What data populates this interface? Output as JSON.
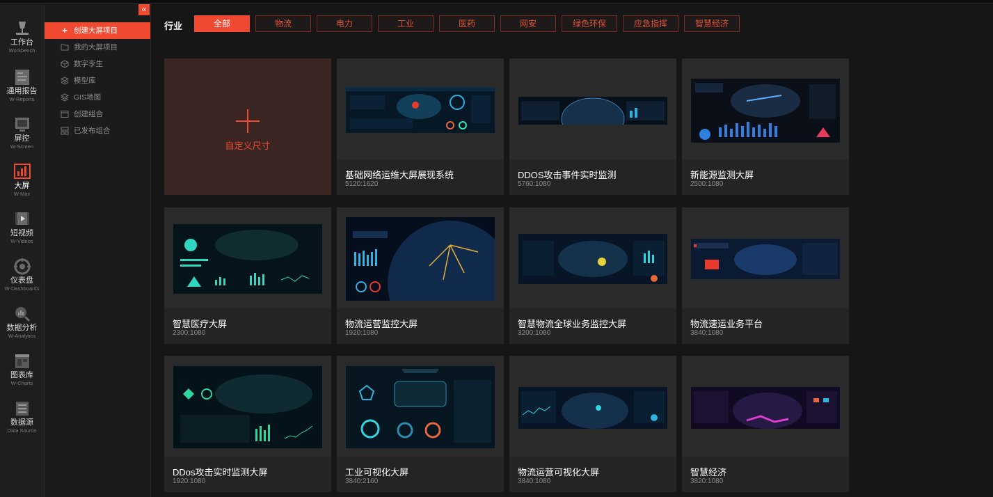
{
  "rail": [
    {
      "label": "工作台",
      "sub": "Workbench",
      "icon": "workbench-icon"
    },
    {
      "label": "通用报告",
      "sub": "W-Reports",
      "icon": "reports-icon"
    },
    {
      "label": "屏控",
      "sub": "W-Screen",
      "icon": "screen-icon"
    },
    {
      "label": "大屏",
      "sub": "W-Max",
      "icon": "bigscreen-icon",
      "active": true
    },
    {
      "label": "短视频",
      "sub": "W-Videos",
      "icon": "video-icon"
    },
    {
      "label": "仪表盘",
      "sub": "W-Dashboards",
      "icon": "dashboard-icon"
    },
    {
      "label": "数据分析",
      "sub": "W-Analytics",
      "icon": "analytics-icon"
    },
    {
      "label": "图表库",
      "sub": "W-Charts",
      "icon": "charts-icon"
    },
    {
      "label": "数据源",
      "sub": "Data Source",
      "icon": "datasource-icon"
    }
  ],
  "submenu": {
    "collapse_glyph": "«",
    "items": [
      {
        "label": "创建大屏项目",
        "icon": "plus-icon",
        "glyph": "+",
        "active": true
      },
      {
        "label": "我的大屏项目",
        "icon": "folder-icon"
      },
      {
        "label": "数字孪生",
        "icon": "cube-icon"
      },
      {
        "label": "模型库",
        "icon": "layers-icon"
      },
      {
        "label": "GIS地图",
        "icon": "layers-icon"
      },
      {
        "label": "创建组合",
        "icon": "window-icon"
      },
      {
        "label": "已发布组合",
        "icon": "grid-icon"
      }
    ]
  },
  "filter": {
    "label": "行业",
    "options": [
      "全部",
      "物流",
      "电力",
      "工业",
      "医药",
      "网安",
      "绿色环保",
      "应急指挥",
      "智慧经济"
    ],
    "selected": "全部"
  },
  "custom_card": {
    "label": "自定义尺寸"
  },
  "templates": [
    {
      "title": "基础网络运维大屏展现系统",
      "ratio": "5120:1620"
    },
    {
      "title": "DDOS攻击事件实时监测",
      "ratio": "5760:1080"
    },
    {
      "title": "新能源监测大屏",
      "ratio": "2500:1080"
    },
    {
      "title": "智慧医疗大屏",
      "ratio": "2300:1080"
    },
    {
      "title": "物流运营监控大屏",
      "ratio": "1920:1080"
    },
    {
      "title": "智慧物流全球业务监控大屏",
      "ratio": "3200:1080"
    },
    {
      "title": "物流速运业务平台",
      "ratio": "3840:1080"
    },
    {
      "title": "DDos攻击实时监测大屏",
      "ratio": "1920:1080"
    },
    {
      "title": "工业可视化大屏",
      "ratio": "3840:2160"
    },
    {
      "title": "物流运营可视化大屏",
      "ratio": "3840:1080"
    },
    {
      "title": "智慧经济",
      "ratio": "3820:1080"
    }
  ],
  "colors": {
    "accent": "#f04a32",
    "bg": "#161616",
    "card": "#242424"
  }
}
